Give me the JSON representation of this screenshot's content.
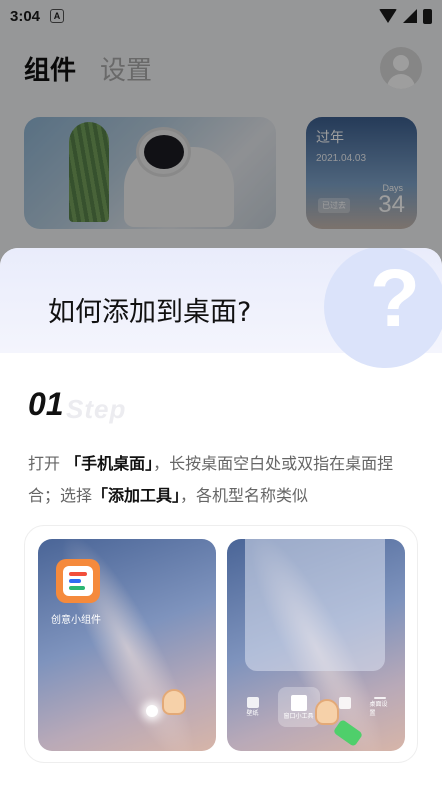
{
  "status_bar": {
    "time": "3:04",
    "notif_icon": "A"
  },
  "header": {
    "tab_widgets": "组件",
    "tab_settings": "设置"
  },
  "countdown_card": {
    "title": "过年",
    "date": "2021.04.03",
    "days_label": "Days",
    "days": "34",
    "tag": "已过去"
  },
  "sheet": {
    "title": "如何添加到桌面?",
    "step_number": "01",
    "step_word": "Step",
    "description": {
      "part1": "打开",
      "bold1": "「手机桌面」",
      "part2": "，长按桌面空白处或双指在桌面捏合；选择",
      "bold2": "「添加工具」",
      "part3": "，各机型名称类似"
    },
    "demo_left_app_label": "创意小组件",
    "demo_right_dock": {
      "item1": "壁纸",
      "item_active": "窗口小工具",
      "item3": "",
      "item4": "桌面设置"
    }
  }
}
